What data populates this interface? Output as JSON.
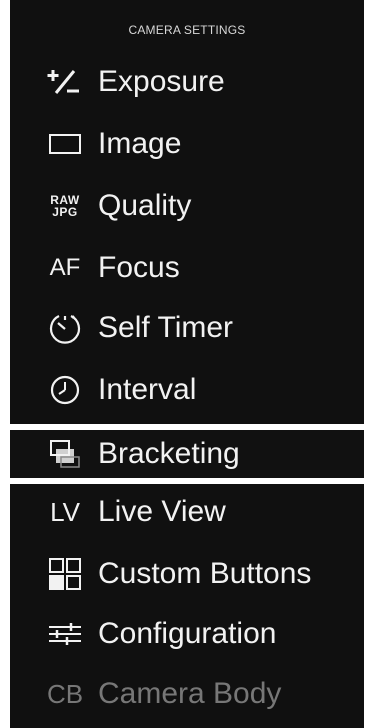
{
  "header": {
    "title": "CAMERA SETTINGS"
  },
  "menu": {
    "items": [
      {
        "label": "Exposure",
        "icon": "exposure-compensation-icon",
        "enabled": true,
        "selected": false
      },
      {
        "label": "Image",
        "icon": "image-frame-icon",
        "enabled": true,
        "selected": false
      },
      {
        "label": "Quality",
        "icon": "raw-jpg-icon",
        "icon_text_top": "RAW",
        "icon_text_bottom": "JPG",
        "enabled": true,
        "selected": false
      },
      {
        "label": "Focus",
        "icon": "af-icon",
        "icon_text": "AF",
        "enabled": true,
        "selected": false
      },
      {
        "label": "Self Timer",
        "icon": "self-timer-icon",
        "enabled": true,
        "selected": false
      },
      {
        "label": "Interval",
        "icon": "clock-icon",
        "enabled": true,
        "selected": false
      },
      {
        "label": "Bracketing",
        "icon": "bracketing-icon",
        "enabled": true,
        "selected": true
      },
      {
        "label": "Live View",
        "icon": "lv-icon",
        "icon_text": "LV",
        "enabled": true,
        "selected": false
      },
      {
        "label": "Custom Buttons",
        "icon": "custom-buttons-grid-icon",
        "enabled": true,
        "selected": false
      },
      {
        "label": "Configuration",
        "icon": "sliders-icon",
        "enabled": true,
        "selected": false
      },
      {
        "label": "Camera Body",
        "icon": "cb-icon",
        "icon_text": "CB",
        "enabled": false,
        "selected": false
      }
    ]
  },
  "colors": {
    "background": "#101010",
    "text": "#f2f2f2",
    "disabled_text": "#777777",
    "selection_outline": "#ffffff"
  }
}
